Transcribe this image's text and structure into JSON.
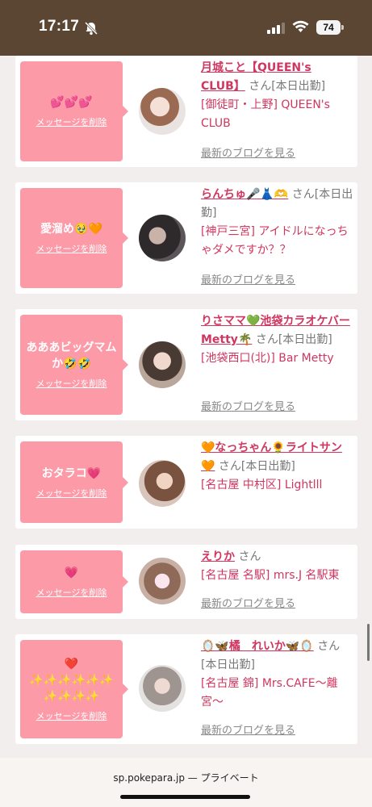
{
  "status": {
    "time": "17:17",
    "battery": "74"
  },
  "footer": {
    "url": "sp.pokepara.jp — プライベート"
  },
  "delete_label": "メッセージを削除",
  "blog_label": "最新のブログを見る",
  "cards": [
    {
      "message": "💕💕💕",
      "name": "月城こと【QUEEN's CLUB】",
      "suffix": "さん[本日出勤]",
      "area": "[御徒町・上野] QUEEN's CLUB"
    },
    {
      "message": "愛溜め🥹🧡",
      "name": "らんちゅ🎤👗🫶",
      "suffix": "さん[本日出勤]",
      "area": "[神戸三宮] アイドルになっちゃダメですか？？"
    },
    {
      "message": "あああビッグマムか🤣🤣",
      "name": "りさママ💚池袋カラオケバーMetty🌴",
      "suffix": "さん[本日出勤]",
      "area": "[池袋西口(北)] Bar Metty"
    },
    {
      "message": "おタラコ💗",
      "name": "🧡なっちゃん🌻ライトサン🧡",
      "suffix": "さん[本日出勤]",
      "area": "[名古屋 中村区] Lightlll"
    },
    {
      "message": "💗",
      "name": "えりか",
      "suffix": "さん",
      "area": "[名古屋 名駅] mrs.J 名駅東"
    },
    {
      "message": "❤️\n✨✨✨✨✨✨\n✨✨✨✨",
      "name": "🪞🦋橘　れいか🦋🪞",
      "suffix": "さん[本日出勤]",
      "area": "[名古屋 錦] Mrs.CAFE〜離宮〜"
    }
  ]
}
